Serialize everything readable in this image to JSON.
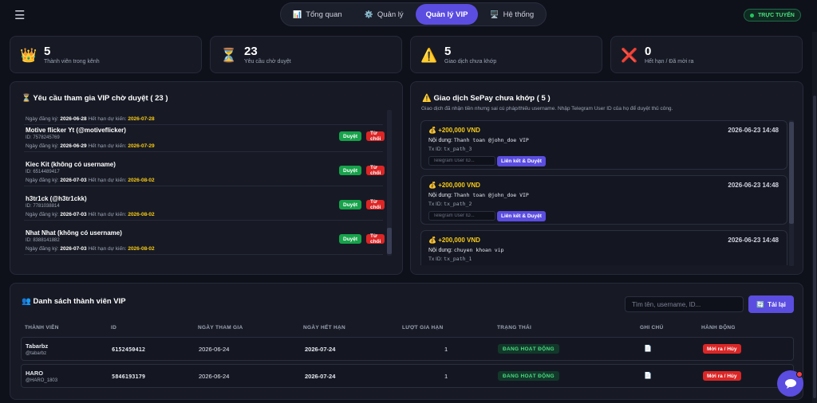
{
  "header": {
    "tabs": [
      {
        "icon": "📊",
        "label": "Tổng quan"
      },
      {
        "icon": "⚙️",
        "label": "Quản lý"
      },
      {
        "icon": "",
        "label": "Quản lý VIP"
      },
      {
        "icon": "🖥️",
        "label": "Hệ thống"
      }
    ],
    "status": "TRỰC TUYẾN"
  },
  "stats": [
    {
      "icon": "👑",
      "value": "5",
      "label": "Thành viên trong kênh"
    },
    {
      "icon": "⏳",
      "value": "23",
      "label": "Yêu cầu chờ duyệt"
    },
    {
      "icon": "⚠️",
      "value": "5",
      "label": "Giao dịch chưa khớp"
    },
    {
      "icon": "❌",
      "value": "0",
      "label": "Hết hạn / Đã mời ra"
    }
  ],
  "requests": {
    "icon": "⏳",
    "title": "Yêu cầu tham gia VIP chờ duyệt ( 23 )",
    "reg_label": "Ngày đăng ký:",
    "exp_label": "Hết hạn dự kiến:",
    "approve": "Duyệt",
    "reject": "Từ chối",
    "items": [
      {
        "name": "Motive flicker Yt (@motiveflicker)",
        "id": "ID: 7578245769",
        "reg": "2026-06-29",
        "exp": "2026-07-29"
      },
      {
        "name": "Kiec Kit (không có username)",
        "id": "ID: 6514489417",
        "reg": "2026-07-03",
        "exp": "2026-08-02"
      },
      {
        "name": "h3tr1ck (@h3tr1ckk)",
        "id": "ID: 7781038814",
        "reg": "2026-07-03",
        "exp": "2026-08-02"
      },
      {
        "name": "Nhat Nhat (không có username)",
        "id": "ID: 8388141882",
        "reg": "2026-07-03",
        "exp": "2026-08-02"
      }
    ]
  },
  "sepay": {
    "icon": "⚠️",
    "title": "Giao dịch SePay chưa khớp ( 5 )",
    "desc": "Giao dịch đã nhận tiền nhưng sai cú pháp/thiếu username. Nhập Telegram User ID của họ để duyệt thủ công.",
    "content_label": "Nội dung:",
    "txid_label": "Tx ID:",
    "input_placeholder": "Telegram User ID...",
    "link_button": "Liên kết & Duyệt",
    "items": [
      {
        "amount": "+200,000 VND",
        "time": "2026-06-23 14:48",
        "content": "Thanh toan @john_doe VIP",
        "txid": "tx_path_3"
      },
      {
        "amount": "+200,000 VND",
        "time": "2026-06-23 14:48",
        "content": "Thanh toan @john_doe VIP",
        "txid": "tx_path_2"
      },
      {
        "amount": "+200,000 VND",
        "time": "2026-06-23 14:48",
        "content": "chuyen khoan vip",
        "txid": "tx_path_1"
      }
    ]
  },
  "members": {
    "icon": "👥",
    "title": "Danh sách thành viên VIP",
    "search_placeholder": "Tìm tên, username, ID...",
    "reload_icon": "🔄",
    "reload_label": "Tải lại",
    "columns": [
      "THÀNH VIÊN",
      "ID",
      "NGÀY THAM GIA",
      "NGÀY HẾT HẠN",
      "LƯỢT GIA HẠN",
      "TRẠNG THÁI",
      "GHI CHÚ",
      "HÀNH ĐỘNG"
    ],
    "rows": [
      {
        "name": "Tabarbz",
        "username": "@tabarbz",
        "id": "6152450412",
        "joined": "2026-06-24",
        "expires": "2026-07-24",
        "renewals": "1",
        "status": "ĐANG HOẠT ĐỘNG",
        "note_icon": "📄",
        "action": "Mời ra / Hủy"
      },
      {
        "name": "HARO",
        "username": "@HARO_1803",
        "id": "5846193179",
        "joined": "2026-06-24",
        "expires": "2026-07-24",
        "renewals": "1",
        "status": "ĐANG HOẠT ĐỘNG",
        "note_icon": "📄",
        "action": "Mời ra / Hủy"
      }
    ]
  },
  "colors": {
    "accent": "#5b4de0",
    "approve": "#16a34a",
    "reject": "#dc2626",
    "warning": "#facc15",
    "online": "#22c55e"
  }
}
